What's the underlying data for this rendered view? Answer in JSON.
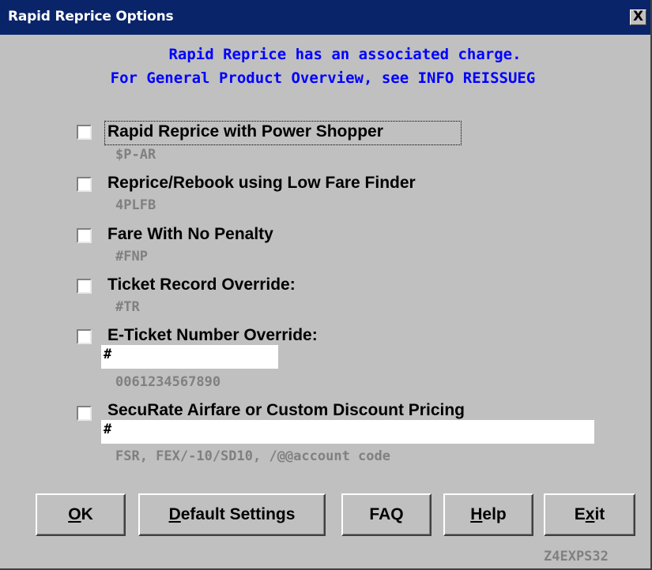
{
  "window": {
    "title": "Rapid Reprice Options",
    "close_glyph": "X"
  },
  "notice": {
    "line1": "Rapid Reprice has an associated charge.",
    "line2": "For General Product Overview, see INFO REISSUEG"
  },
  "options": [
    {
      "label": "Rapid Reprice with Power Shopper",
      "command": "$P-AR",
      "checked": false
    },
    {
      "label": "Reprice/Rebook using Low Fare Finder",
      "command": "4PLFB",
      "checked": false
    },
    {
      "label": "Fare With No Penalty",
      "command": "#FNP",
      "checked": false
    },
    {
      "label": "Ticket Record Override:",
      "command": "#TR",
      "checked": false
    },
    {
      "label": "E-Ticket Number Override:",
      "input_value": "#",
      "hint": "0061234567890",
      "checked": false
    },
    {
      "label": "SecuRate Airfare or Custom Discount Pricing",
      "input_value": "#",
      "hint": "FSR, FEX/-10/SD10, /@@account code",
      "checked": false
    }
  ],
  "buttons": {
    "ok": {
      "mnemonic": "O",
      "rest": "K"
    },
    "default_settings": {
      "mnemonic": "D",
      "rest": "efault Settings"
    },
    "faq": {
      "label": "FAQ"
    },
    "help": {
      "mnemonic": "H",
      "rest": "elp"
    },
    "exit": {
      "pre": "E",
      "mnemonic": "x",
      "rest": "it"
    }
  },
  "screen_id": "Z4EXPS32",
  "colors": {
    "titlebar": "#0a246a",
    "window_bg": "#c0c0c0",
    "notice_text": "#0000ff",
    "hint_text": "#808080"
  }
}
